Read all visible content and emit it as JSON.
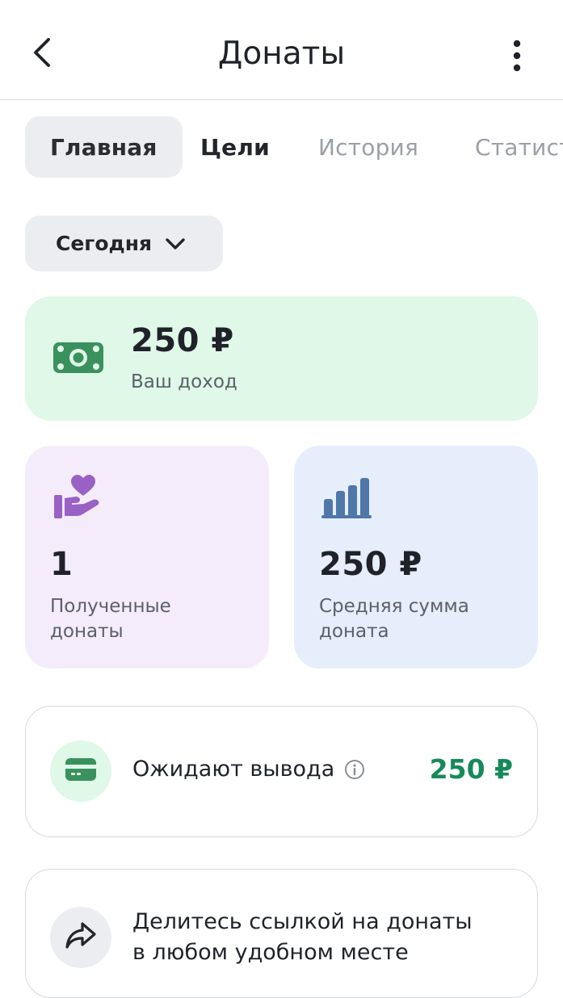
{
  "header": {
    "title": "Донаты",
    "back_icon": "chevron-left-icon",
    "menu_icon": "more-vertical-icon"
  },
  "tabs": [
    {
      "label": "Главная",
      "active": true
    },
    {
      "label": "Цели",
      "active": false
    },
    {
      "label": "История",
      "active": false
    },
    {
      "label": "Статист",
      "active": false
    }
  ],
  "period": {
    "label": "Сегодня",
    "icon": "chevron-down-icon"
  },
  "income": {
    "value": "250 ₽",
    "label": "Ваш доход",
    "icon": "money-icon",
    "color": "#dff8e8"
  },
  "received": {
    "value": "1",
    "label_line1": "Полученные",
    "label_line2": "донаты",
    "icon": "heart-hand-icon",
    "color": "#f4ecfb"
  },
  "average": {
    "value": "250 ₽",
    "label_line1": "Средняя сумма",
    "label_line2": "доната",
    "icon": "bar-chart-icon",
    "color": "#e6eefb"
  },
  "pending": {
    "label": "Ожидают вывода",
    "value": "250 ₽",
    "icon": "card-icon",
    "info_icon": "info-icon",
    "value_color": "#168a5a"
  },
  "share": {
    "line1": "Делитесь ссылкой на донаты",
    "line2": "в любом удобном месте",
    "icon": "share-arrow-icon"
  }
}
